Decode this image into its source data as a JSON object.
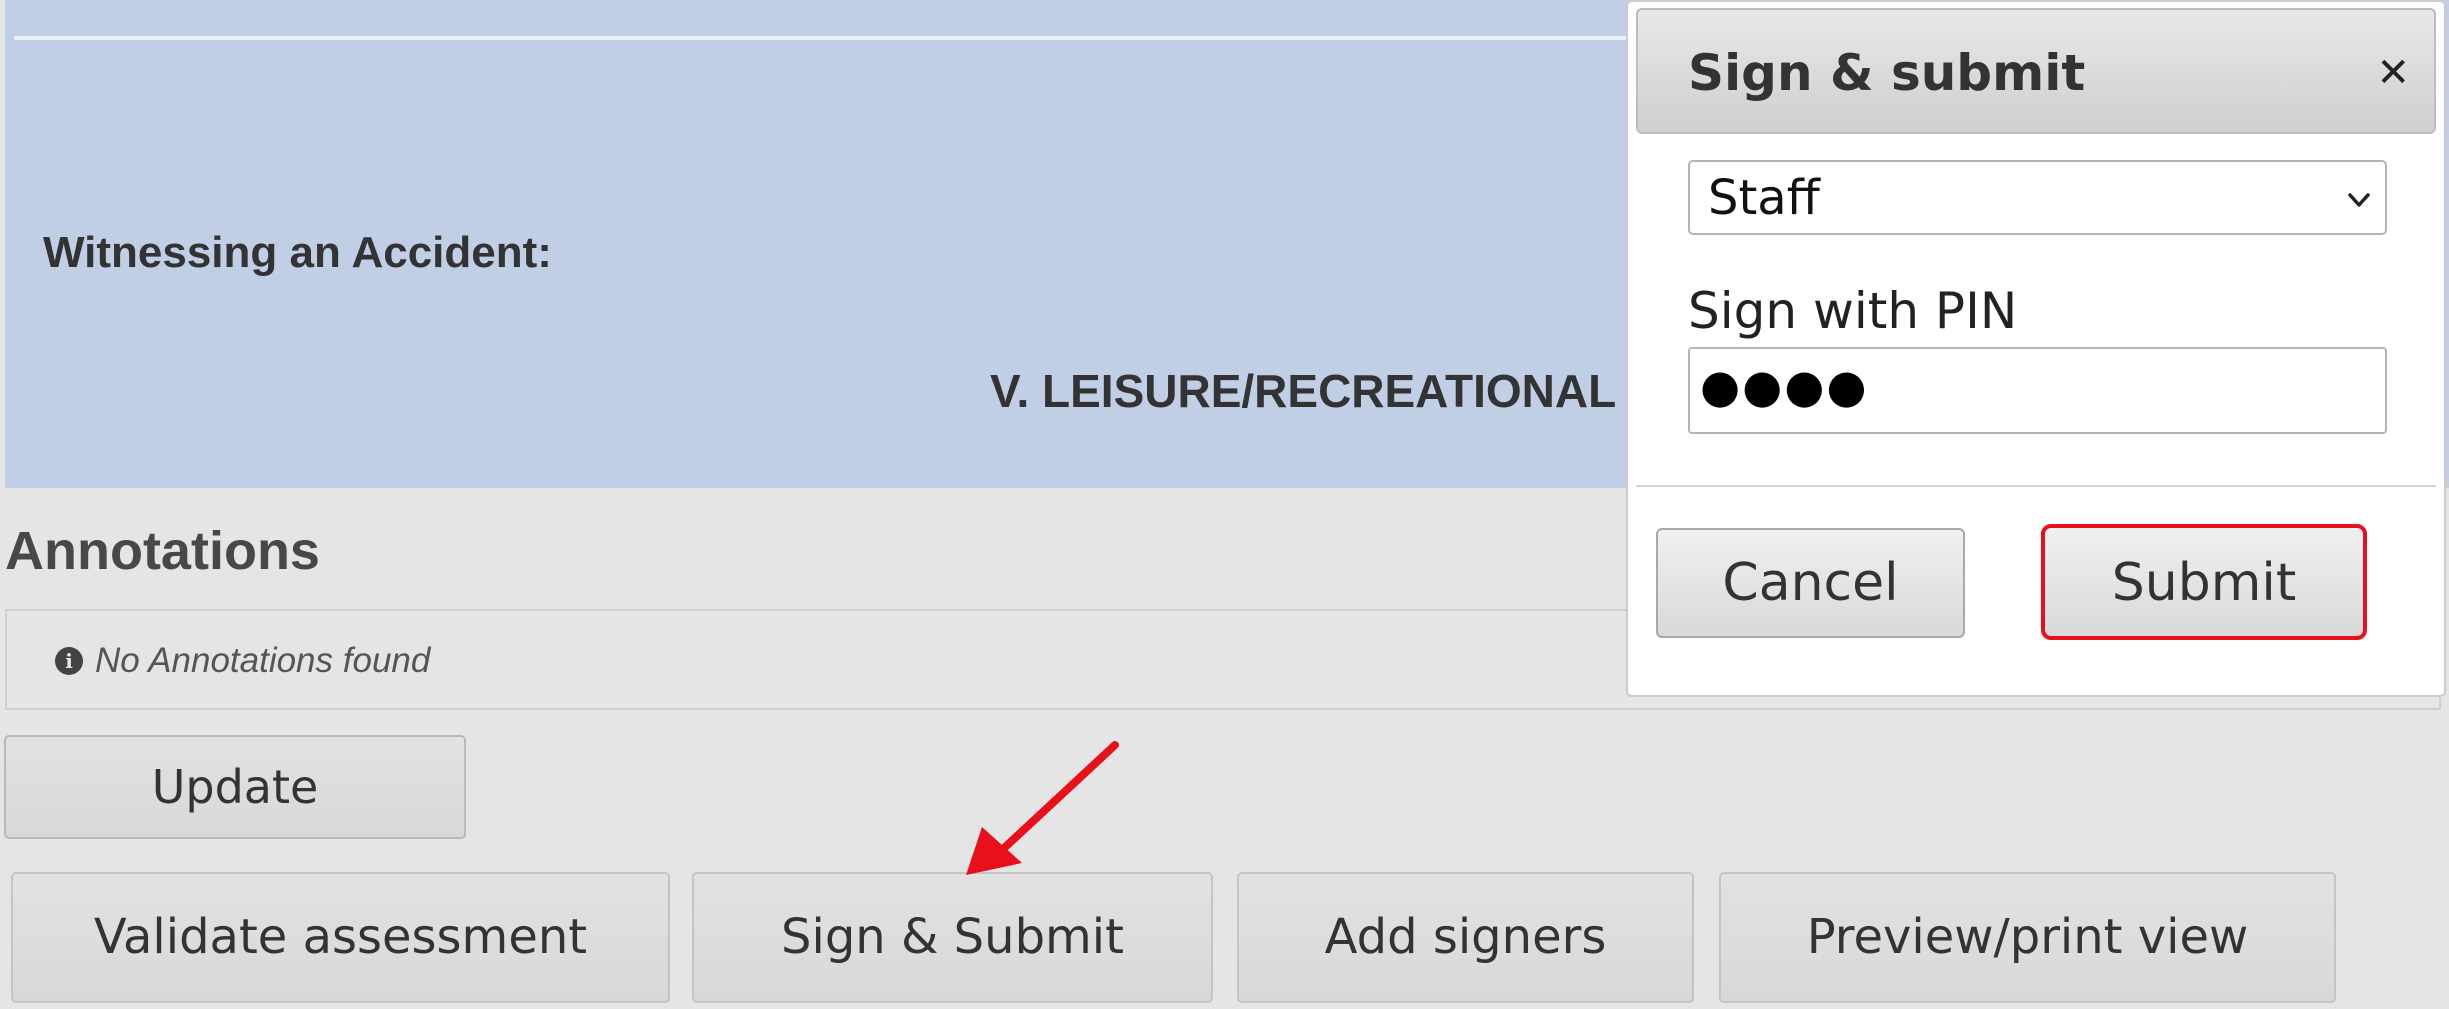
{
  "form": {
    "witness_label": "Witnessing an Accident:",
    "section_heading": "V. LEISURE/RECREATIONAL"
  },
  "annotations": {
    "title": "Annotations",
    "empty_message": "No Annotations found",
    "info_icon": "info-circle-icon"
  },
  "actions": {
    "update_label": "Update",
    "validate_label": "Validate assessment",
    "sign_submit_label": "Sign & Submit",
    "add_signers_label": "Add signers",
    "preview_label": "Preview/print view"
  },
  "dialog": {
    "title": "Sign & submit",
    "close_icon": "close-icon",
    "role_selected": "Staff",
    "pin_label": "Sign with PIN",
    "pin_masked": "●●●●",
    "cancel_label": "Cancel",
    "submit_label": "Submit"
  },
  "colors": {
    "form_background": "#c0cfe5",
    "page_background": "#e5e5e5",
    "highlight": "#e8101a",
    "annotation_arrow": "#e8101a"
  }
}
